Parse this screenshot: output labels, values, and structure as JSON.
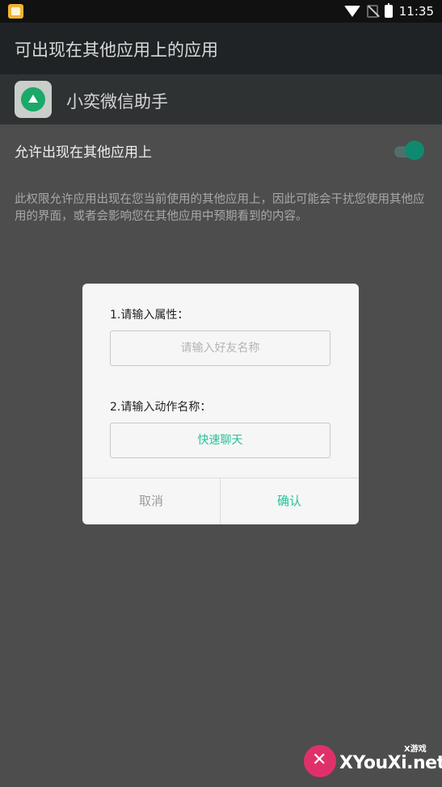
{
  "statusbar": {
    "time": "11:35"
  },
  "appbar": {
    "title": "可出现在其他应用上的应用"
  },
  "app": {
    "name": "小奕微信助手"
  },
  "permission": {
    "label": "允许出现在其他应用上",
    "enabled": true,
    "description": "此权限允许应用出现在您当前使用的其他应用上，因此可能会干扰您使用其他应用的界面，或者会影响您在其他应用中预期看到的内容。"
  },
  "dialog": {
    "q1_label": "1.请输入属性：",
    "q1_placeholder": "请输入好友名称",
    "q2_label": "2.请输入动作名称：",
    "q2_value": "快速聊天",
    "cancel_label": "取消",
    "confirm_label": "确认"
  },
  "watermark": {
    "main": "XYouXi.net",
    "small": "X游戏"
  },
  "colors": {
    "accent": "#26c29a",
    "toggle": "#0f8a70",
    "appbar": "#1f2325"
  }
}
